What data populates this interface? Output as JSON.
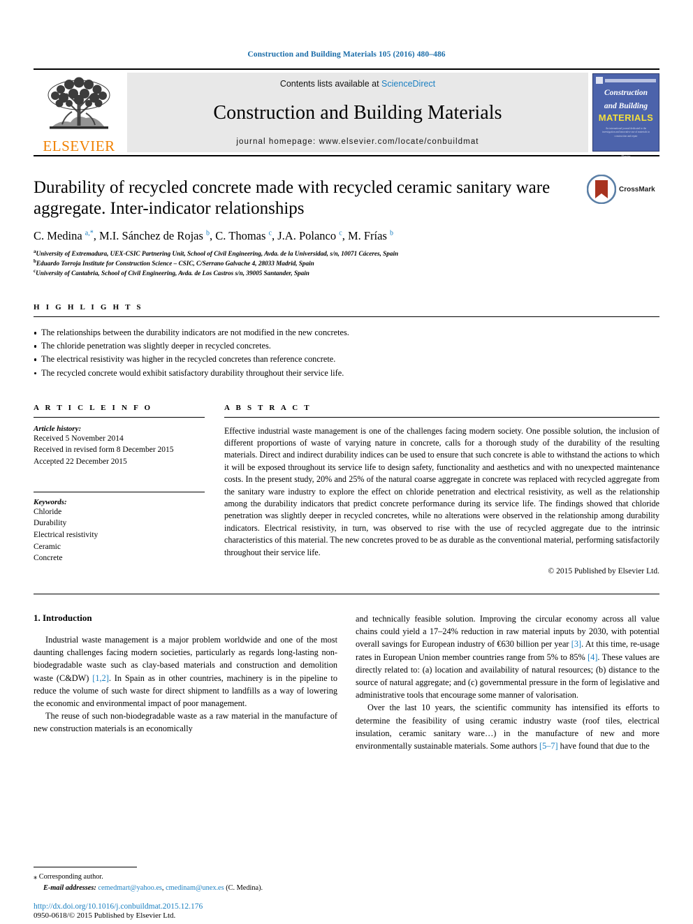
{
  "running_head": "Construction and Building Materials 105 (2016) 480–486",
  "masthead": {
    "publisher_name": "ELSEVIER",
    "contents_prefix": "Contents lists available at",
    "contents_link": "ScienceDirect",
    "journal_title": "Construction and Building Materials",
    "homepage": "journal homepage: www.elsevier.com/locate/conbuildmat",
    "cover": {
      "line1": "Construction",
      "line2": "and Building",
      "line3": "MATERIALS",
      "blurb": "An international journal dedicated to the investigation and innovative use of materials in construction and repair",
      "foot": "Elsevier"
    }
  },
  "article": {
    "title": "Durability of recycled concrete made with recycled ceramic sanitary ware aggregate. Inter-indicator relationships",
    "crossmark_label": "CrossMark",
    "authors_html": "C. Medina <sup class=\"star\">a,</sup><sup class=\"star\">*</sup>, M.I. Sánchez de Rojas <sup>b</sup>, C. Thomas <sup>c</sup>, J.A. Polanco <sup>c</sup>, M. Frías <sup>b</sup>",
    "affiliations": [
      "University of Extremadura, UEX-CSIC Partnering Unit, School of Civil Engineering, Avda. de la Universidad, s/n, 10071 Cáceres, Spain",
      "Eduardo Torroja Institute for Construction Science – CSIC, C/Serrano Galvache 4, 28033 Madrid, Spain",
      "University of Cantabria, School of Civil Engineering, Avda. de Los Castros s/n, 39005 Santander, Spain"
    ],
    "affiliation_marks": [
      "a",
      "b",
      "c"
    ]
  },
  "highlights": {
    "heading": "H I G H L I G H T S",
    "items": [
      "The relationships between the durability indicators are not modified in the new concretes.",
      "The chloride penetration was slightly deeper in recycled concretes.",
      "The electrical resistivity was higher in the recycled concretes than reference concrete.",
      "The recycled concrete would exhibit satisfactory durability throughout their service life."
    ]
  },
  "article_info": {
    "heading": "A R T I C L E  I N F O",
    "history_label": "Article history:",
    "history": [
      "Received 5 November 2014",
      "Received in revised form 8 December 2015",
      "Accepted 22 December 2015"
    ],
    "keywords_label": "Keywords:",
    "keywords": [
      "Chloride",
      "Durability",
      "Electrical resistivity",
      "Ceramic",
      "Concrete"
    ]
  },
  "abstract": {
    "heading": "A B S T R A C T",
    "text": "Effective industrial waste management is one of the challenges facing modern society. One possible solution, the inclusion of different proportions of waste of varying nature in concrete, calls for a thorough study of the durability of the resulting materials. Direct and indirect durability indices can be used to ensure that such concrete is able to withstand the actions to which it will be exposed throughout its service life to design safety, functionality and aesthetics and with no unexpected maintenance costs. In the present study, 20% and 25% of the natural coarse aggregate in concrete was replaced with recycled aggregate from the sanitary ware industry to explore the effect on chloride penetration and electrical resistivity, as well as the relationship among the durability indicators that predict concrete performance during its service life. The findings showed that chloride penetration was slightly deeper in recycled concretes, while no alterations were observed in the relationship among durability indicators. Electrical resistivity, in turn, was observed to rise with the use of recycled aggregate due to the intrinsic characteristics of this material. The new concretes proved to be as durable as the conventional material, performing satisfactorily throughout their service life.",
    "copyright": "© 2015 Published by Elsevier Ltd."
  },
  "introduction": {
    "heading": "1. Introduction",
    "left_paragraphs": [
      "Industrial waste management is a major problem worldwide and one of the most daunting challenges facing modern societies, particularly as regards long-lasting non-biodegradable waste such as clay-based materials and construction and demolition waste (C&DW) [1,2]. In Spain as in other countries, machinery is in the pipeline to reduce the volume of such waste for direct shipment to landfills as a way of lowering the economic and environmental impact of poor management.",
      "The reuse of such non-biodegradable waste as a raw material in the manufacture of new construction materials is an economically"
    ],
    "right_paragraphs": [
      "and technically feasible solution. Improving the circular economy across all value chains could yield a 17–24% reduction in raw material inputs by 2030, with potential overall savings for European industry of €630 billion per year [3]. At this time, re-usage rates in European Union member countries range from 5% to 85% [4]. These values are directly related to: (a) location and availability of natural resources; (b) distance to the source of natural aggregate; and (c) governmental pressure in the form of legislative and administrative tools that encourage some manner of valorisation.",
      "Over the last 10 years, the scientific community has intensified its efforts to determine the feasibility of using ceramic industry waste (roof tiles, electrical insulation, ceramic sanitary ware…) in the manufacture of new and more environmentally sustainable materials. Some authors [5–7] have found that due to the"
    ],
    "citations": [
      "[1,2]",
      "[3]",
      "[4]",
      "[5–7]"
    ]
  },
  "footnotes": {
    "corresponding_marker": "⁎",
    "corresponding_text": "Corresponding author.",
    "email_label": "E-mail addresses:",
    "emails": [
      "cemedmart@yahoo.es",
      "cmedinam@unex.es"
    ],
    "email_owner": "(C. Medina).",
    "doi": "http://dx.doi.org/10.1016/j.conbuildmat.2015.12.176",
    "issn_line": "0950-0618/© 2015 Published by Elsevier Ltd."
  },
  "colors": {
    "link_blue": "#1a7fc1",
    "running_head_blue": "#1a6ca8",
    "elsevier_orange": "#f08000",
    "cover_blue": "#4c63ab",
    "cover_yellow": "#f5e03c",
    "crossmark_red": "#a8331f"
  }
}
